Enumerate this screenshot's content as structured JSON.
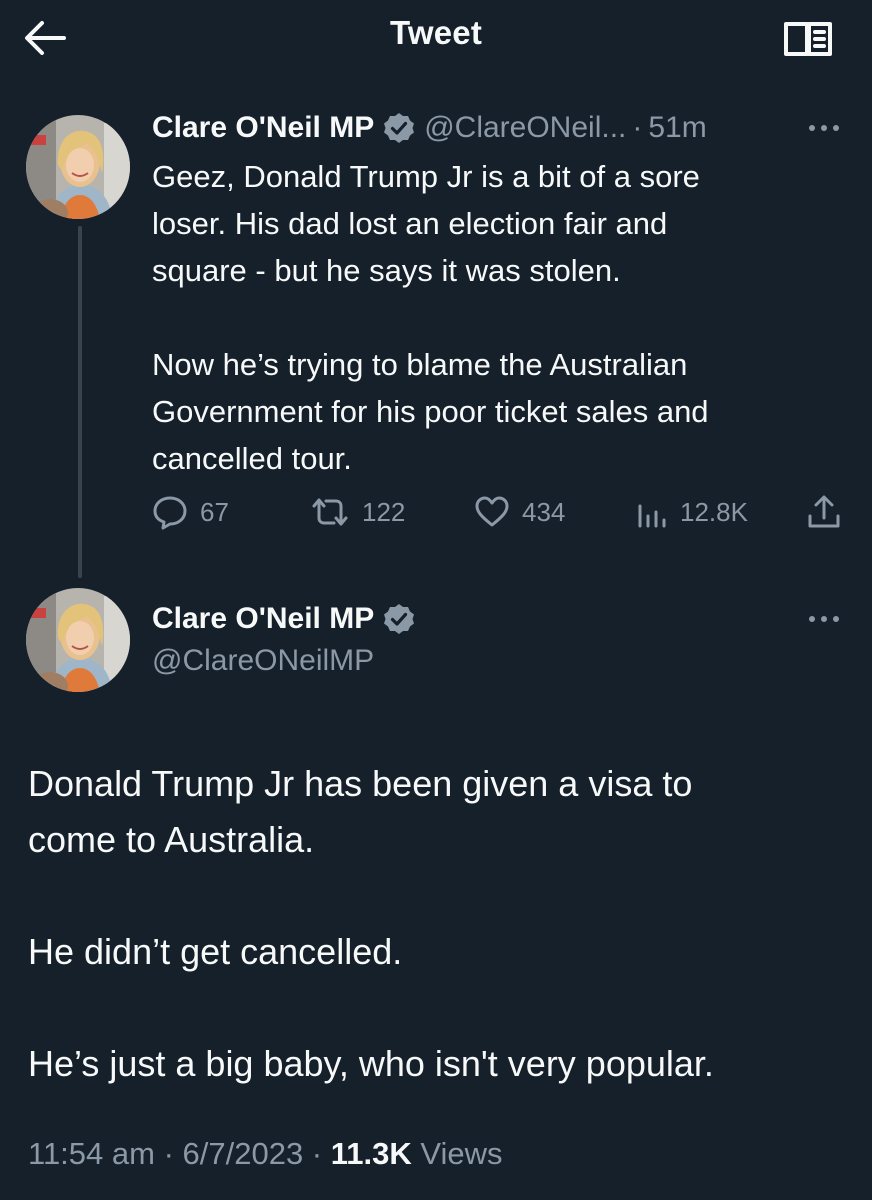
{
  "header": {
    "title": "Tweet"
  },
  "quoted_tweet": {
    "author_name": "Clare O'Neil MP",
    "handle": "@ClareONeil...",
    "separator": "·",
    "time": "51m",
    "text": "Geez, Donald Trump Jr is a bit of a sore\nloser. His dad lost an election fair and\nsquare - but he says it was stolen.\n\nNow he’s trying to blame the Australian\nGovernment for his poor ticket sales and\ncancelled tour.",
    "replies": "67",
    "retweets": "122",
    "likes": "434",
    "views": "12.8K"
  },
  "main_tweet": {
    "author_name": "Clare O'Neil MP",
    "handle": "@ClareONeilMP",
    "text": "Donald Trump Jr has been given a visa to\ncome to Australia.\n\nHe didn’t get cancelled.\n\nHe’s just a big baby, who isn't very popular.",
    "time": "11:54 am",
    "separator1": " · ",
    "date": "6/7/2023",
    "separator2": " · ",
    "views_count": "11.3K",
    "views_label": " Views"
  },
  "icons": {
    "back": "arrow-left-icon",
    "reader": "reader-mode-icon",
    "verified": "verified-badge-icon",
    "more": "more-dots-icon",
    "reply": "reply-bubble-icon",
    "retweet": "retweet-icon",
    "like": "heart-icon",
    "views": "bar-chart-icon",
    "share": "share-upload-icon"
  },
  "colors": {
    "background": "#15202b",
    "text_primary": "#f7f9f9",
    "text_secondary": "#8b98a5",
    "thread_line": "#38444d"
  }
}
